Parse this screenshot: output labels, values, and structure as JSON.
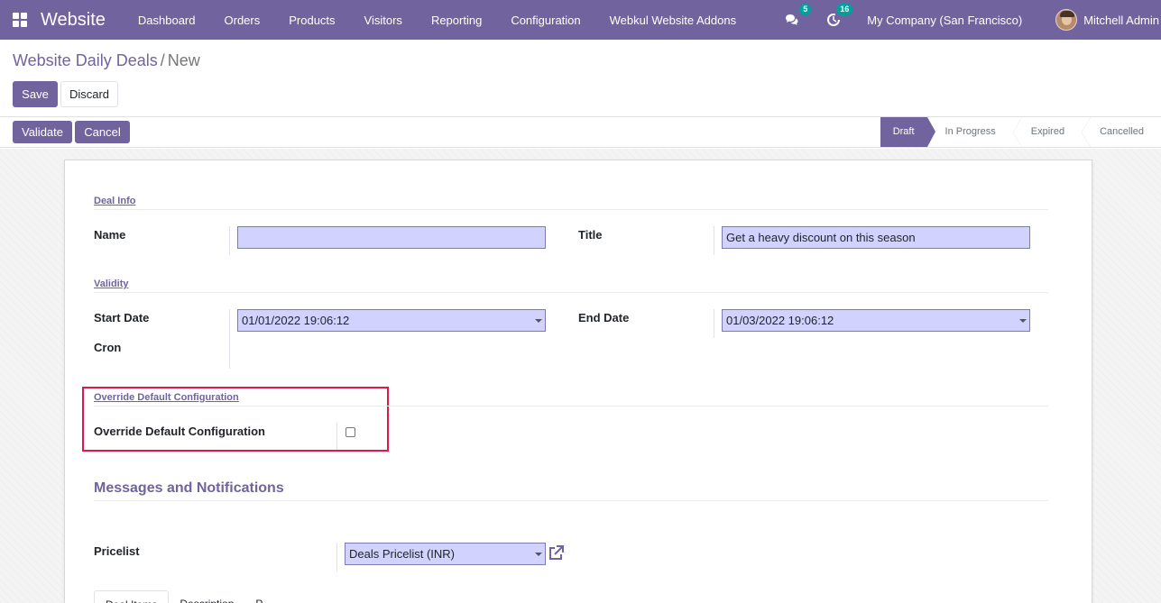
{
  "navbar": {
    "app_name": "Website",
    "menu": [
      "Dashboard",
      "Orders",
      "Products",
      "Visitors",
      "Reporting",
      "Configuration",
      "Webkul Website Addons"
    ],
    "messages_count": "5",
    "activities_count": "16",
    "company": "My Company (San Francisco)",
    "user": "Mitchell Admin"
  },
  "breadcrumb": {
    "parent": "Website Daily Deals",
    "separator": "/",
    "current": "New"
  },
  "buttons": {
    "save": "Save",
    "discard": "Discard",
    "validate": "Validate",
    "cancel": "Cancel"
  },
  "stages": [
    "Draft",
    "In Progress",
    "Expired",
    "Cancelled"
  ],
  "active_stage": "Draft",
  "form": {
    "deal_info_title": "Deal Info",
    "name_label": "Name",
    "name_value": "",
    "title_label": "Title",
    "title_value": "Get a heavy discount on this season",
    "validity_title": "Validity",
    "start_date_label": "Start Date",
    "start_date_value": "01/01/2022 19:06:12",
    "end_date_label": "End Date",
    "end_date_value": "01/03/2022 19:06:12",
    "cron_label": "Cron",
    "override_title": "Override Default Configuration",
    "override_label": "Override Default Configuration",
    "override_checked": false,
    "messages_heading": "Messages and Notifications",
    "pricelist_label": "Pricelist",
    "pricelist_value": "Deals Pricelist (INR)"
  },
  "tabs": [
    "Deal Items",
    "Description",
    "P"
  ],
  "colors": {
    "brand": "#71639e",
    "highlight": "#e0174b",
    "required_field": "#d2d2ff",
    "badge": "#00a09d"
  }
}
